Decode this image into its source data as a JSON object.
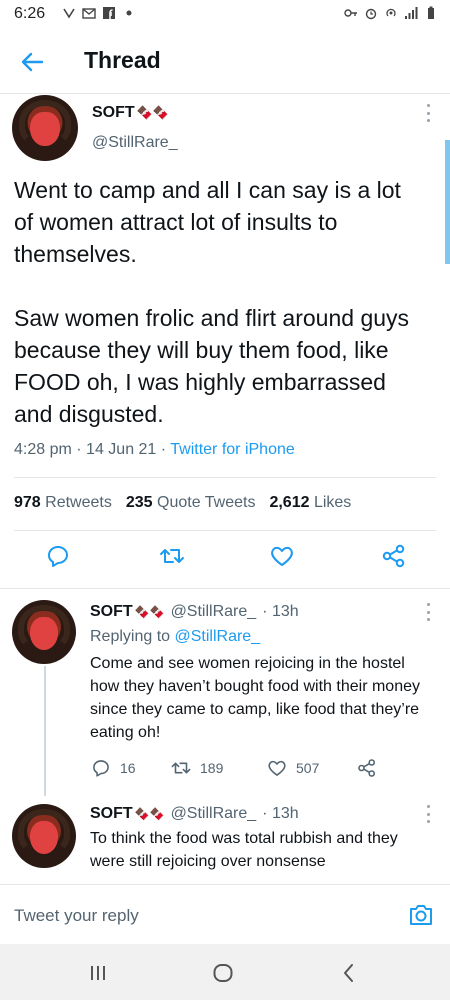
{
  "status_bar": {
    "time": "6:26",
    "icons": [
      "alert-icon",
      "mail-icon",
      "facebook-icon",
      "dot-icon",
      "key-icon",
      "alarm-icon",
      "hotspot-icon",
      "signal-icon",
      "battery-icon"
    ]
  },
  "header": {
    "title": "Thread",
    "back_icon": "arrow-left-icon"
  },
  "main_tweet": {
    "author_name": "SOFT",
    "author_emoji": "🍫🍫",
    "handle": "@StillRare_",
    "text": "Went to camp and all I can say is a lot of women attract lot of insults to themselves.\n\nSaw women frolic and flirt around guys because they will buy them food, like FOOD oh, I was highly embarrassed and disgusted.",
    "time": "4:28 pm",
    "date": "14 Jun 21",
    "source": "Twitter for iPhone",
    "retweets_count": "978",
    "retweets_label": "Retweets",
    "quotes_count": "235",
    "quotes_label": "Quote Tweets",
    "likes_count": "2,612",
    "likes_label": "Likes",
    "actions": [
      "reply-icon",
      "retweet-icon",
      "like-icon",
      "share-icon"
    ]
  },
  "replies": [
    {
      "author_name": "SOFT",
      "author_emoji": "🍫🍫",
      "handle": "@StillRare_",
      "age": "· 13h",
      "replying_label": "Replying to",
      "replying_to": "@StillRare_",
      "text": "Come and see women rejoicing in the hostel how they haven’t bought food with their money since they came to camp, like food that they’re eating oh!",
      "reply_count": "16",
      "retweet_count": "189",
      "like_count": "507"
    },
    {
      "author_name": "SOFT",
      "author_emoji": "🍫🍫",
      "handle": "@StillRare_",
      "age": "· 13h",
      "text": "To think the food was total rubbish and they were still rejoicing over nonsense"
    }
  ],
  "reply_bar": {
    "placeholder": "Tweet your reply",
    "camera_icon": "camera-icon"
  },
  "nav_bar": {
    "icons": [
      "recent-apps-icon",
      "home-icon",
      "back-icon"
    ]
  },
  "colors": {
    "accent": "#1d9bf0",
    "text": "#0f1419",
    "muted": "#536471"
  }
}
